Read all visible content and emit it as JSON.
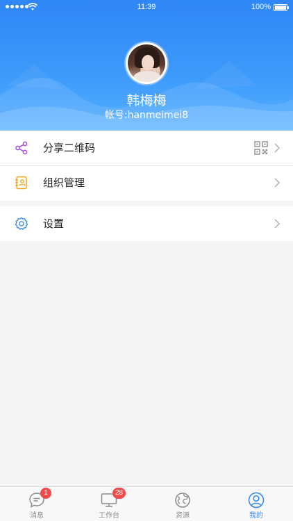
{
  "status_bar": {
    "time": "11:39",
    "battery": "100%"
  },
  "profile": {
    "name": "韩梅梅",
    "account": "帐号:hanmeimei8"
  },
  "menu": {
    "share_qr": "分享二维码",
    "org_manage": "组织管理",
    "settings": "设置"
  },
  "tabbar": {
    "messages": {
      "label": "消息",
      "badge": "1"
    },
    "workbench": {
      "label": "工作台",
      "badge": "28"
    },
    "resources": {
      "label": "资源"
    },
    "mine": {
      "label": "我的"
    }
  },
  "colors": {
    "brand": "#2f86f6",
    "badge": "#f24a4a"
  }
}
